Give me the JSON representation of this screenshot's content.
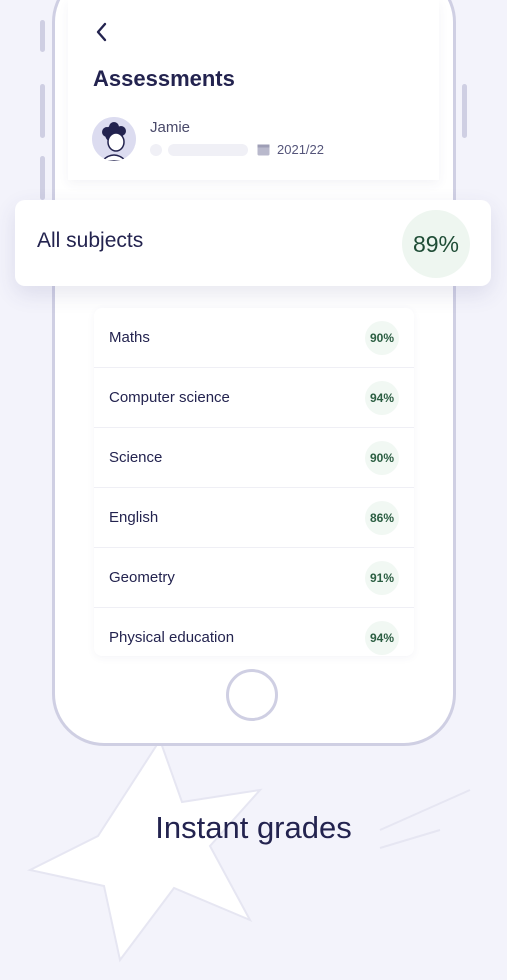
{
  "header": {
    "title": "Assessments",
    "back_icon": "chevron-left-icon"
  },
  "profile": {
    "name": "Jamie",
    "year": "2021/22",
    "calendar_icon": "calendar-icon"
  },
  "summary": {
    "label": "All subjects",
    "score": "89%"
  },
  "subjects": [
    {
      "name": "Maths",
      "score": "90%"
    },
    {
      "name": "Computer science",
      "score": "94%"
    },
    {
      "name": "Science",
      "score": "90%"
    },
    {
      "name": "English",
      "score": "86%"
    },
    {
      "name": "Geometry",
      "score": "91%"
    },
    {
      "name": "Physical education",
      "score": "94%"
    }
  ],
  "tagline": "Instant grades",
  "colors": {
    "background": "#f3f3fb",
    "text": "#23234f",
    "score_text": "#1f4d36",
    "score_bg": "#eef6f0",
    "frame": "#cfcfe3"
  }
}
